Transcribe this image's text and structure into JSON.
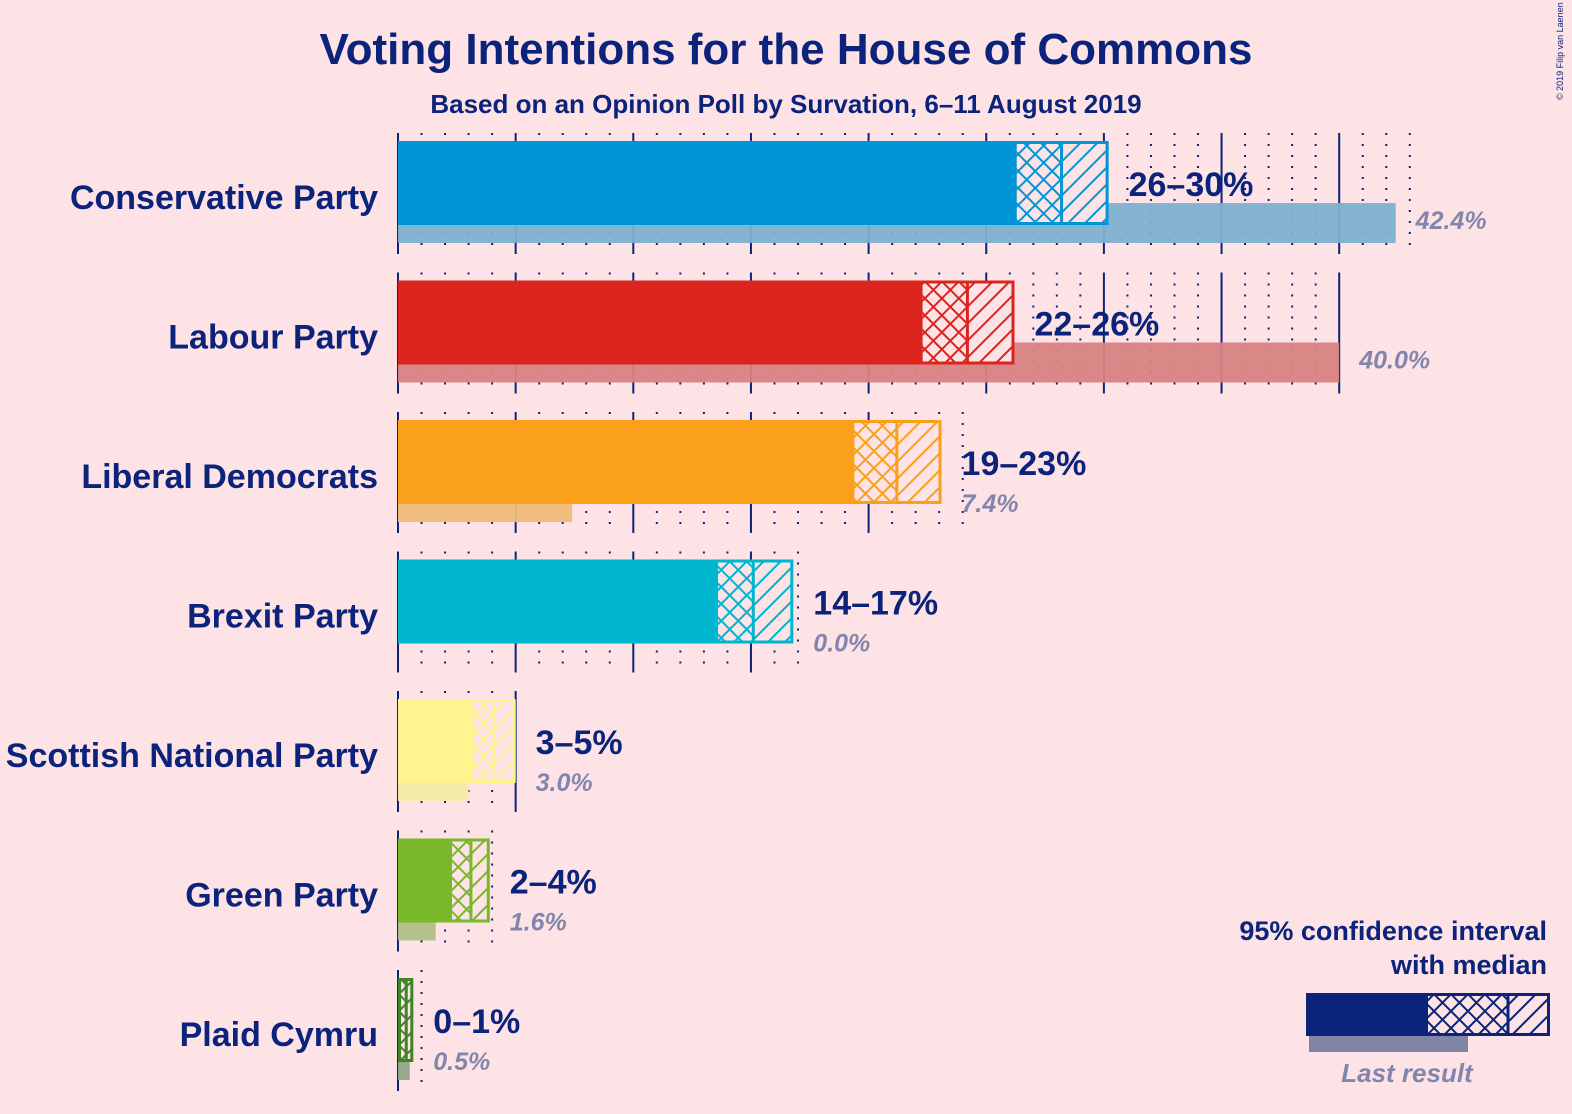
{
  "chart_data": {
    "type": "bar",
    "title": "Voting Intentions for the House of Commons",
    "subtitle": "Based on an Opinion Poll by Survation, 6–11 August 2019",
    "copyright": "© 2019 Filip van Laenen",
    "unit": "%",
    "grid": true,
    "series": [
      {
        "name": "Conservative Party",
        "range_label": "26–30%",
        "low": 26.3,
        "median": 28.2,
        "high": 30.2,
        "last_result": 42.4,
        "last_label": "42.4%",
        "color": "#0096d6",
        "last_color": "#80b0d0"
      },
      {
        "name": "Labour Party",
        "range_label": "22–26%",
        "low": 22.3,
        "median": 24.2,
        "high": 26.2,
        "last_result": 40.0,
        "last_label": "40.0%",
        "color": "#dc241f",
        "last_color": "#d88282"
      },
      {
        "name": "Liberal Democrats",
        "range_label": "19–23%",
        "low": 19.4,
        "median": 21.2,
        "high": 23.1,
        "last_result": 7.4,
        "last_label": "7.4%",
        "color": "#faa01a",
        "last_color": "#f0bb78"
      },
      {
        "name": "Brexit Party",
        "range_label": "14–17%",
        "low": 13.6,
        "median": 15.1,
        "high": 16.8,
        "last_result": 0.0,
        "last_label": "0.0%",
        "color": "#00b6cf",
        "last_color": "#80c8d8"
      },
      {
        "name": "Scottish National Party",
        "range_label": "3–5%",
        "low": 3.2,
        "median": 4.1,
        "high": 5.0,
        "last_result": 3.0,
        "last_label": "3.0%",
        "color": "#fff48d",
        "last_color": "#f6eaa6"
      },
      {
        "name": "Green Party",
        "range_label": "2–4%",
        "low": 2.3,
        "median": 3.1,
        "high": 3.9,
        "last_result": 1.6,
        "last_label": "1.6%",
        "color": "#78b82a",
        "last_color": "#b0bf85"
      },
      {
        "name": "Plaid Cymru",
        "range_label": "0–1%",
        "low": 0.0,
        "median": 0.35,
        "high": 0.65,
        "last_result": 0.5,
        "last_label": "0.5%",
        "color": "#3f8428",
        "last_color": "#90a888"
      }
    ],
    "legend": {
      "title_line1": "95% confidence interval",
      "title_line2": "with median",
      "last_result_label": "Last result",
      "color": "#0b237a",
      "last_color": "#8286a4",
      "placement": "bottom-right"
    }
  }
}
